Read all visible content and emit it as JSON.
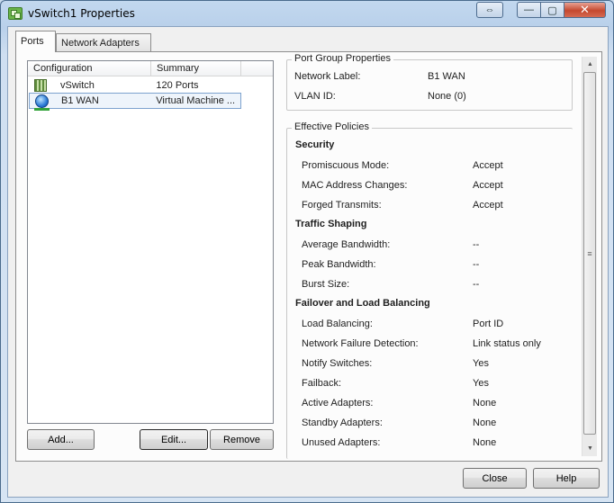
{
  "window": {
    "title": "vSwitch1 Properties",
    "icon": "vsphere-app-icon",
    "controls": {
      "restore": "⇔",
      "minimize": "—",
      "maximize": "▢",
      "close": "✕"
    }
  },
  "tabs": [
    {
      "label": "Ports",
      "active": true
    },
    {
      "label": "Network Adapters",
      "active": false
    }
  ],
  "list": {
    "columns": [
      "Configuration",
      "Summary"
    ],
    "rows": [
      {
        "icon": "vswitch-icon",
        "name": "vSwitch",
        "summary": "120 Ports",
        "selected": false
      },
      {
        "icon": "vm-network-icon",
        "name": "B1 WAN",
        "summary": "Virtual Machine ...",
        "selected": true
      }
    ]
  },
  "list_buttons": {
    "add": "Add...",
    "edit": "Edit...",
    "remove": "Remove"
  },
  "port_group": {
    "legend": "Port Group Properties",
    "network_label": {
      "label": "Network Label:",
      "value": "B1 WAN"
    },
    "vlan_id": {
      "label": "VLAN ID:",
      "value": "None (0)"
    }
  },
  "effective_policies": {
    "legend": "Effective Policies",
    "security": {
      "title": "Security",
      "items": [
        {
          "label": "Promiscuous Mode:",
          "value": "Accept"
        },
        {
          "label": "MAC Address Changes:",
          "value": "Accept"
        },
        {
          "label": "Forged Transmits:",
          "value": "Accept"
        }
      ]
    },
    "traffic_shaping": {
      "title": "Traffic Shaping",
      "items": [
        {
          "label": "Average Bandwidth:",
          "value": "--"
        },
        {
          "label": "Peak Bandwidth:",
          "value": "--"
        },
        {
          "label": "Burst Size:",
          "value": "--"
        }
      ]
    },
    "failover": {
      "title": "Failover and Load Balancing",
      "items": [
        {
          "label": "Load Balancing:",
          "value": "Port ID"
        },
        {
          "label": "Network Failure Detection:",
          "value": "Link status only"
        },
        {
          "label": "Notify Switches:",
          "value": "Yes"
        },
        {
          "label": "Failback:",
          "value": "Yes"
        },
        {
          "label": "Active Adapters:",
          "value": "None"
        },
        {
          "label": "Standby Adapters:",
          "value": "None"
        },
        {
          "label": "Unused Adapters:",
          "value": "None"
        }
      ]
    }
  },
  "dialog_buttons": {
    "close": "Close",
    "help": "Help"
  }
}
